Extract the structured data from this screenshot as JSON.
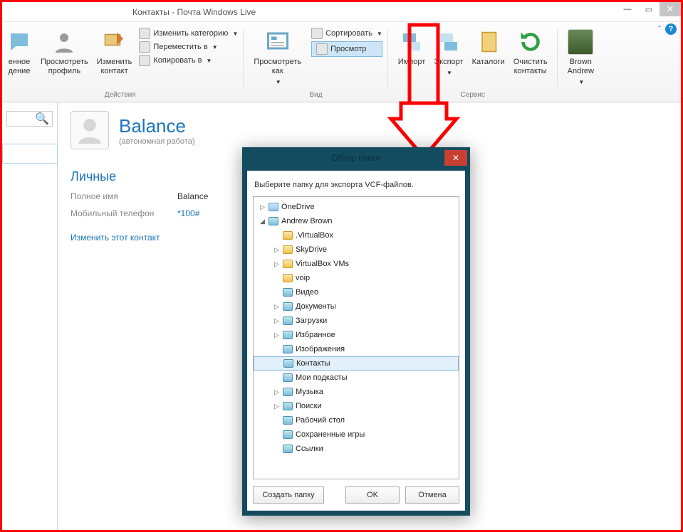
{
  "window": {
    "title": "Контакты - Почта Windows Live"
  },
  "ribbon": {
    "groups": {
      "actions": {
        "label": "Действия",
        "l0a": "енное",
        "l0b": "дение",
        "view_profile": "Просмотреть\nпрофиль",
        "edit_contact": "Изменить\nконтакт",
        "change_category": "Изменить категорию",
        "move_to": "Переместить в",
        "copy_to": "Копировать в"
      },
      "view": {
        "label": "Вид",
        "view_as": "Просмотреть\nкак",
        "sort_by": "Сортировать",
        "preview": "Просмотр"
      },
      "service": {
        "label": "Сервис",
        "import": "Импорт",
        "export": "Экспорт",
        "catalogs": "Каталоги",
        "clear": "Очистить\nконтакты"
      },
      "user": {
        "name": "Brown\nAndrew"
      }
    }
  },
  "contact": {
    "name": "Balance",
    "status": "(автономная работа)",
    "section": "Личные",
    "fullname_label": "Полное имя",
    "fullname_value": "Balance",
    "mobile_label": "Мобильный телефон",
    "mobile_value": "*100#",
    "edit": "Изменить этот контакт"
  },
  "dialog": {
    "title": "Обзор папок",
    "message": "Выберите папку для экспорта VCF-файлов.",
    "buttons": {
      "create": "Создать папку",
      "ok": "OK",
      "cancel": "Отмена"
    },
    "tree": [
      {
        "level": 0,
        "twisty": "▷",
        "icon": "cloud",
        "label": "OneDrive"
      },
      {
        "level": 0,
        "twisty": "◢",
        "icon": "sys",
        "label": "Andrew Brown"
      },
      {
        "level": 1,
        "twisty": "",
        "icon": "folder",
        "label": ".VirtualBox"
      },
      {
        "level": 1,
        "twisty": "▷",
        "icon": "folder",
        "label": "SkyDrive"
      },
      {
        "level": 1,
        "twisty": "▷",
        "icon": "folder",
        "label": "VirtualBox VMs"
      },
      {
        "level": 1,
        "twisty": "",
        "icon": "folder",
        "label": "voip"
      },
      {
        "level": 1,
        "twisty": "",
        "icon": "sys",
        "label": "Видео"
      },
      {
        "level": 1,
        "twisty": "▷",
        "icon": "sys",
        "label": "Документы"
      },
      {
        "level": 1,
        "twisty": "▷",
        "icon": "sys",
        "label": "Загрузки"
      },
      {
        "level": 1,
        "twisty": "▷",
        "icon": "sys",
        "label": "Избранное"
      },
      {
        "level": 1,
        "twisty": "",
        "icon": "sys",
        "label": "Изображения"
      },
      {
        "level": 1,
        "twisty": "",
        "icon": "sys",
        "label": "Контакты",
        "selected": true
      },
      {
        "level": 1,
        "twisty": "",
        "icon": "sys",
        "label": "Мои подкасты"
      },
      {
        "level": 1,
        "twisty": "▷",
        "icon": "sys",
        "label": "Музыка"
      },
      {
        "level": 1,
        "twisty": "▷",
        "icon": "sys",
        "label": "Поиски"
      },
      {
        "level": 1,
        "twisty": "",
        "icon": "sys",
        "label": "Рабочий стол"
      },
      {
        "level": 1,
        "twisty": "",
        "icon": "sys",
        "label": "Сохраненные игры"
      },
      {
        "level": 1,
        "twisty": "",
        "icon": "sys",
        "label": "Ссылки"
      }
    ]
  }
}
